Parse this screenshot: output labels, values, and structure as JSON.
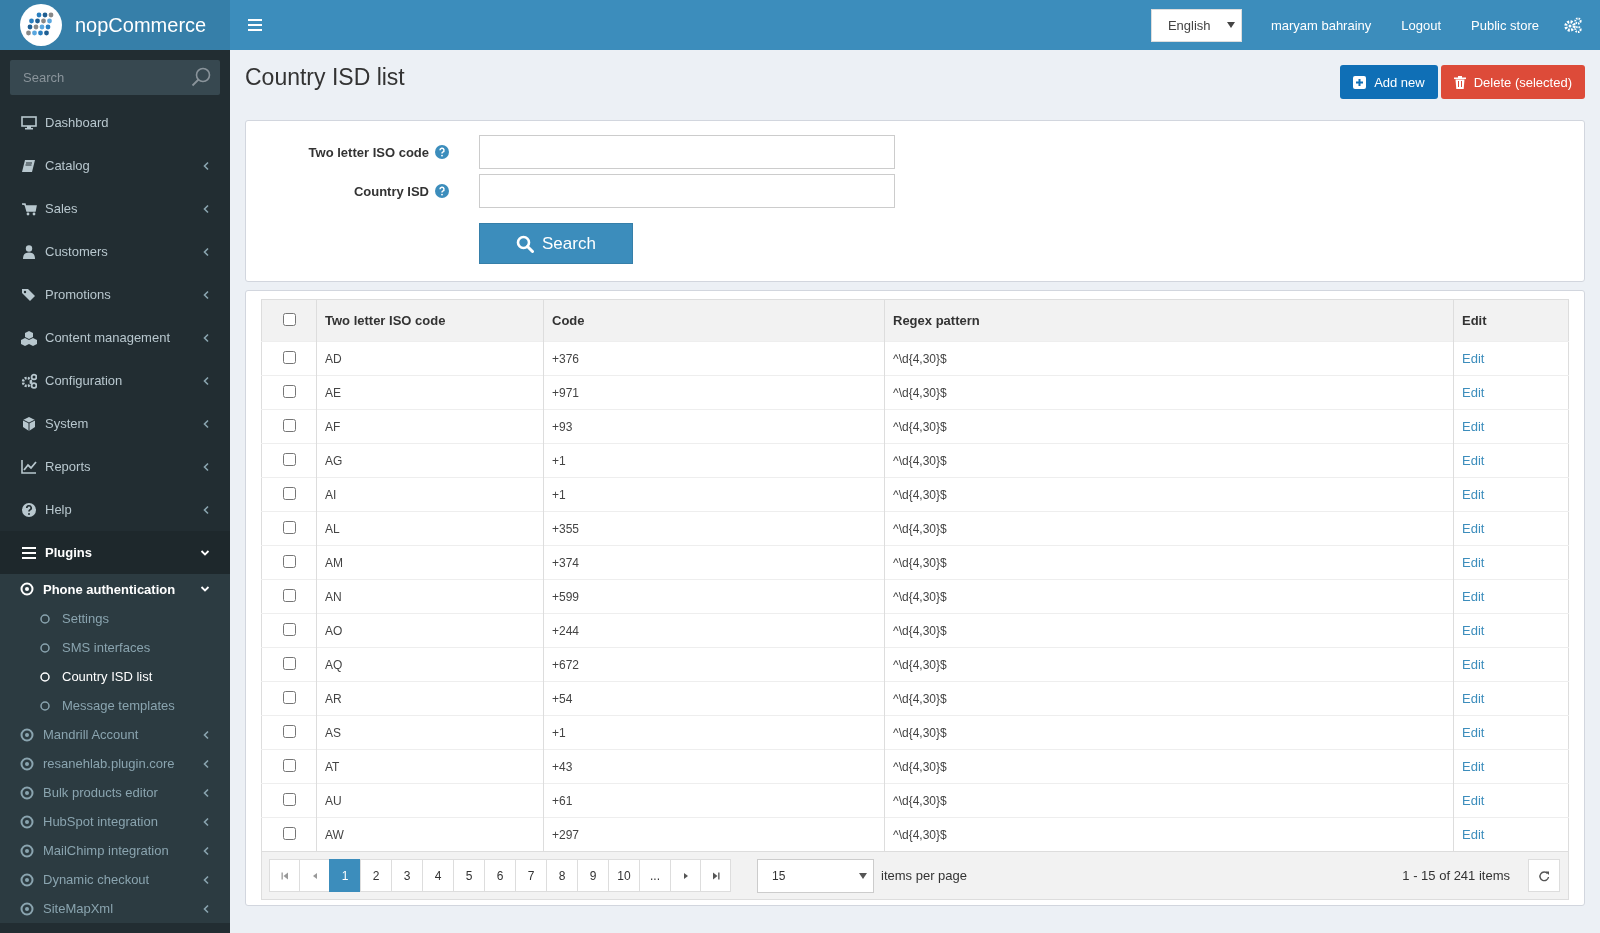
{
  "header": {
    "logo": "nopCommerce",
    "language": "English",
    "user": "maryam bahrainy",
    "links": [
      "Logout",
      "Public store"
    ]
  },
  "sidebar": {
    "search": {
      "placeholder": "Search"
    },
    "items": [
      {
        "label": "Dashboard",
        "kind": "link",
        "selected": false
      },
      {
        "label": "Catalog",
        "kind": "submenu",
        "expanded": false,
        "selected": false
      },
      {
        "label": "Sales",
        "kind": "submenu",
        "expanded": false,
        "selected": false
      },
      {
        "label": "Customers",
        "kind": "submenu",
        "expanded": false,
        "selected": false
      },
      {
        "label": "Promotions",
        "kind": "submenu",
        "expanded": false,
        "selected": false
      },
      {
        "label": "Content management",
        "kind": "submenu",
        "expanded": false,
        "selected": false
      },
      {
        "label": "Configuration",
        "kind": "submenu",
        "expanded": false,
        "selected": false
      },
      {
        "label": "System",
        "kind": "submenu",
        "expanded": false,
        "selected": false
      },
      {
        "label": "Reports",
        "kind": "submenu",
        "expanded": false,
        "selected": false
      },
      {
        "label": "Help",
        "kind": "submenu",
        "expanded": false,
        "selected": false
      },
      {
        "label": "Plugins",
        "kind": "submenu",
        "expanded": true,
        "selected": true,
        "children": [
          {
            "label": "Phone authentication",
            "expanded": true,
            "children": [
              {
                "label": "Settings",
                "selected": false
              },
              {
                "label": "SMS interfaces",
                "selected": false
              },
              {
                "label": "Country ISD list",
                "selected": true
              },
              {
                "label": "Message templates",
                "selected": false
              }
            ]
          },
          {
            "label": "Mandrill Account",
            "expanded": false
          },
          {
            "label": "resanehlab.plugin.core",
            "expanded": false
          },
          {
            "label": "Bulk products editor",
            "expanded": false
          },
          {
            "label": "HubSpot integration",
            "expanded": false
          },
          {
            "label": "MailChimp integration",
            "expanded": false
          },
          {
            "label": "Dynamic checkout",
            "expanded": false
          },
          {
            "label": "SiteMapXml",
            "expanded": false
          }
        ]
      }
    ]
  },
  "page": {
    "title": "Country ISD list",
    "buttons": [
      {
        "label": "Add new",
        "kind": "add"
      },
      {
        "label": "Delete (selected)",
        "kind": "delete"
      }
    ]
  },
  "search_form": {
    "fields": [
      {
        "label": "Two letter ISO code"
      },
      {
        "label": "Country ISD"
      }
    ],
    "button": "Search"
  },
  "table": {
    "select_all": {
      "checked": false
    },
    "columns": [
      "Two letter ISO code",
      "Code",
      "Regex pattern",
      "Edit"
    ],
    "rows": [
      {
        "checked": false,
        "iso": "AD",
        "code": "+376",
        "regex": "^\\d{4,30}$",
        "edit": "Edit"
      },
      {
        "checked": false,
        "iso": "AE",
        "code": "+971",
        "regex": "^\\d{4,30}$",
        "edit": "Edit"
      },
      {
        "checked": false,
        "iso": "AF",
        "code": "+93",
        "regex": "^\\d{4,30}$",
        "edit": "Edit"
      },
      {
        "checked": false,
        "iso": "AG",
        "code": "+1",
        "regex": "^\\d{4,30}$",
        "edit": "Edit"
      },
      {
        "checked": false,
        "iso": "AI",
        "code": "+1",
        "regex": "^\\d{4,30}$",
        "edit": "Edit"
      },
      {
        "checked": false,
        "iso": "AL",
        "code": "+355",
        "regex": "^\\d{4,30}$",
        "edit": "Edit"
      },
      {
        "checked": false,
        "iso": "AM",
        "code": "+374",
        "regex": "^\\d{4,30}$",
        "edit": "Edit"
      },
      {
        "checked": false,
        "iso": "AN",
        "code": "+599",
        "regex": "^\\d{4,30}$",
        "edit": "Edit"
      },
      {
        "checked": false,
        "iso": "AO",
        "code": "+244",
        "regex": "^\\d{4,30}$",
        "edit": "Edit"
      },
      {
        "checked": false,
        "iso": "AQ",
        "code": "+672",
        "regex": "^\\d{4,30}$",
        "edit": "Edit"
      },
      {
        "checked": false,
        "iso": "AR",
        "code": "+54",
        "regex": "^\\d{4,30}$",
        "edit": "Edit"
      },
      {
        "checked": false,
        "iso": "AS",
        "code": "+1",
        "regex": "^\\d{4,30}$",
        "edit": "Edit"
      },
      {
        "checked": false,
        "iso": "AT",
        "code": "+43",
        "regex": "^\\d{4,30}$",
        "edit": "Edit"
      },
      {
        "checked": false,
        "iso": "AU",
        "code": "+61",
        "regex": "^\\d{4,30}$",
        "edit": "Edit"
      },
      {
        "checked": false,
        "iso": "AW",
        "code": "+297",
        "regex": "^\\d{4,30}$",
        "edit": "Edit"
      }
    ]
  },
  "pager": {
    "pages": [
      {
        "label": "1",
        "selected": true
      },
      {
        "label": "2",
        "selected": false
      },
      {
        "label": "3",
        "selected": false
      },
      {
        "label": "4",
        "selected": false
      },
      {
        "label": "5",
        "selected": false
      },
      {
        "label": "6",
        "selected": false
      },
      {
        "label": "7",
        "selected": false
      },
      {
        "label": "8",
        "selected": false
      },
      {
        "label": "9",
        "selected": false
      },
      {
        "label": "10",
        "selected": false
      },
      {
        "label": "...",
        "selected": false
      }
    ],
    "page_size": "15",
    "page_size_label": "items per page",
    "summary": "1 - 15 of 241 items"
  }
}
